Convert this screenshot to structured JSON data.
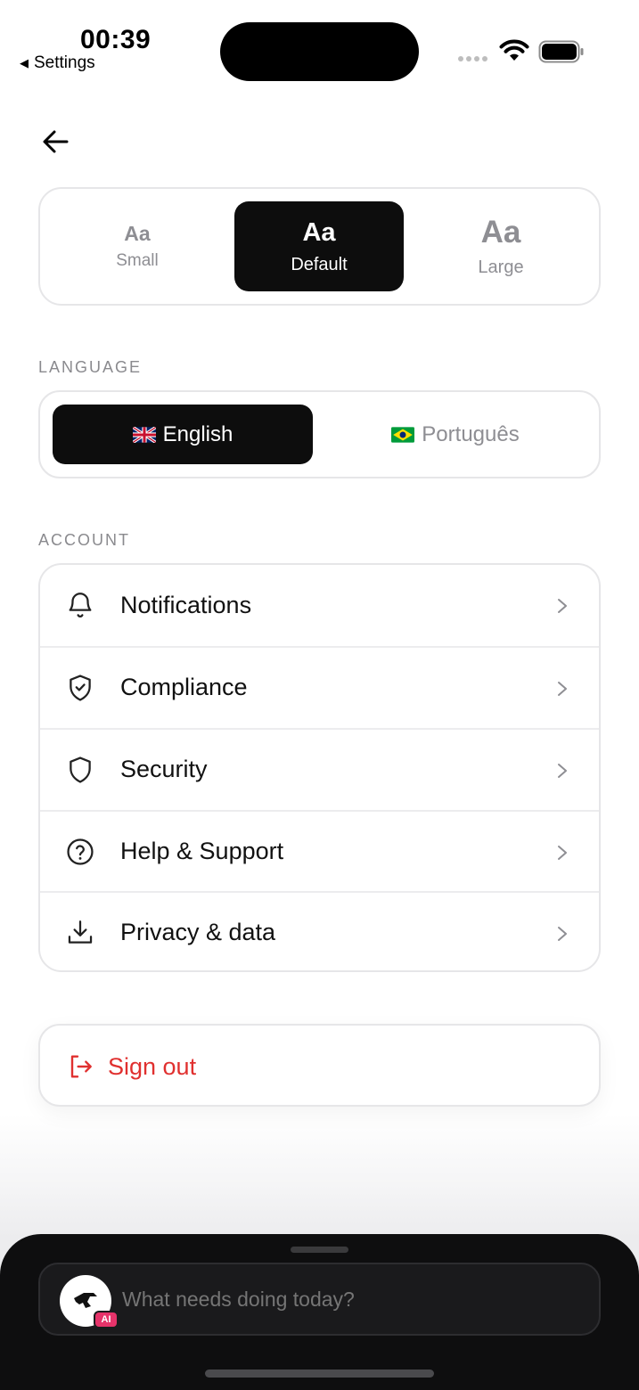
{
  "status_bar": {
    "time": "00:39",
    "back_app": "Settings"
  },
  "text_size": {
    "options": [
      {
        "sample": "Aa",
        "label": "Small"
      },
      {
        "sample": "Aa",
        "label": "Default"
      },
      {
        "sample": "Aa",
        "label": "Large"
      }
    ],
    "selected": "Default"
  },
  "language": {
    "section_label": "LANGUAGE",
    "options": [
      {
        "label": "English",
        "flag": "uk-flag-icon"
      },
      {
        "label": "Português",
        "flag": "brazil-flag-icon"
      }
    ],
    "selected": "English"
  },
  "account": {
    "section_label": "ACCOUNT",
    "items": [
      {
        "label": "Notifications",
        "icon": "bell-icon"
      },
      {
        "label": "Compliance",
        "icon": "shield-check-icon"
      },
      {
        "label": "Security",
        "icon": "shield-icon"
      },
      {
        "label": "Help & Support",
        "icon": "help-circle-icon"
      },
      {
        "label": "Privacy & data",
        "icon": "download-icon"
      }
    ]
  },
  "sign_out": {
    "label": "Sign out",
    "color": "#e0302f"
  },
  "assistant": {
    "placeholder": "What needs doing today?",
    "badge": "AI",
    "badge_color": "#e6336a"
  }
}
